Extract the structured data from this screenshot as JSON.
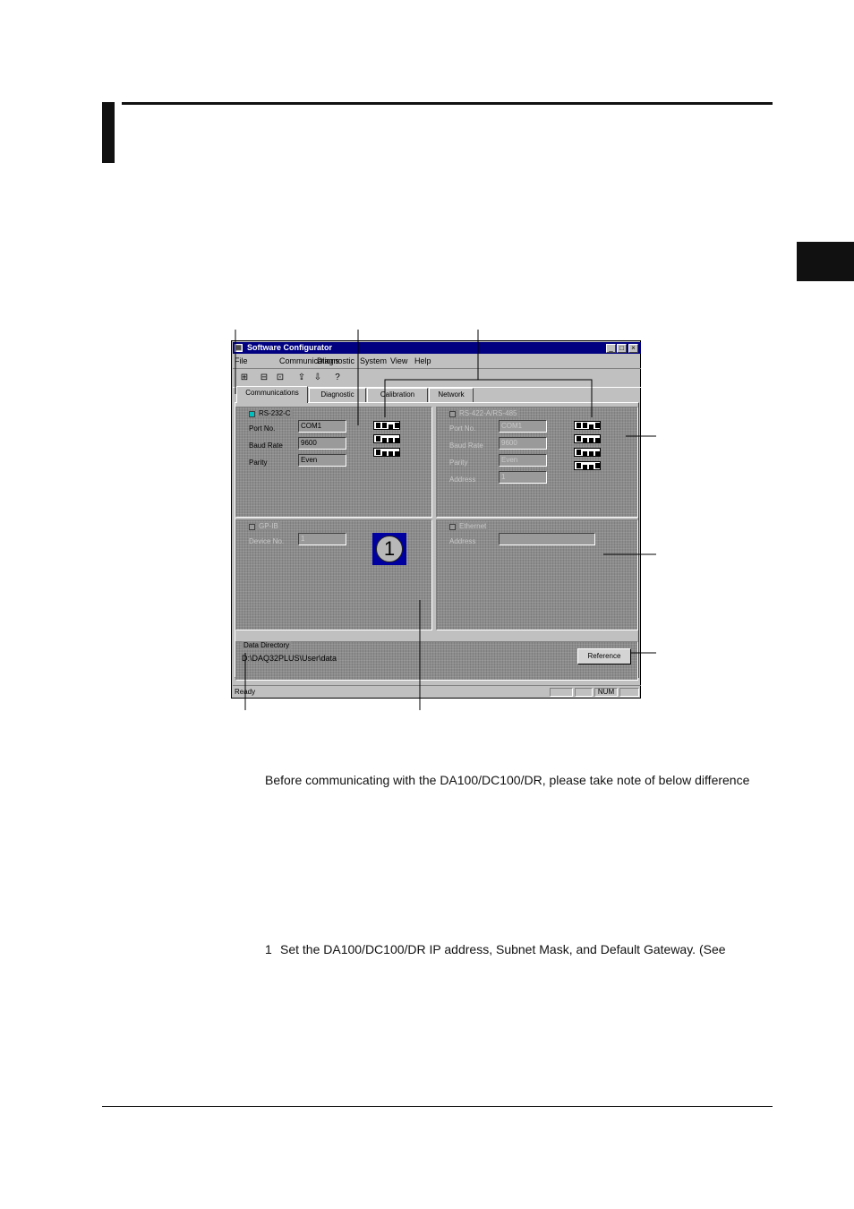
{
  "window": {
    "title": "Software Configurator",
    "menu": [
      "File",
      "Communications",
      "Diagnostic",
      "System",
      "View",
      "Help"
    ],
    "toolbar_icons": [
      "open-icon",
      "save-icon",
      "print-icon",
      "send-icon",
      "receive-icon",
      "help-icon"
    ],
    "tabs": [
      "Communications",
      "Diagnostic",
      "Calibration",
      "Network"
    ],
    "rs232": {
      "label": "RS-232-C",
      "port_label": "Port No.",
      "port_value": "COM1",
      "baud_label": "Baud Rate",
      "baud_value": "9600",
      "parity_label": "Parity",
      "parity_value": "Even"
    },
    "rs422": {
      "label": "RS-422-A/RS-485",
      "port_label": "Port No.",
      "port_value": "COM1",
      "baud_label": "Baud Rate",
      "baud_value": "9600",
      "parity_label": "Parity",
      "parity_value": "Even",
      "address_label": "Address",
      "address_value": "1"
    },
    "gpib": {
      "label": "GP-IB",
      "device_label": "Device No.",
      "device_value": "1",
      "badge": "1"
    },
    "ethernet": {
      "label": "Ethernet",
      "address_label": "Address",
      "address_value": ""
    },
    "data_directory": {
      "label": "Data Directory",
      "path": "D:\\DAQ32PLUS\\User\\data",
      "button": "Reference"
    },
    "status": {
      "text": "Ready",
      "num": "NUM"
    }
  },
  "body_text": {
    "note": "Before communicating with the DA100/DC100/DR, please take note of below difference",
    "step_number": "1",
    "step_text": "Set the DA100/DC100/DR IP address, Subnet Mask, and Default Gateway. (See"
  }
}
